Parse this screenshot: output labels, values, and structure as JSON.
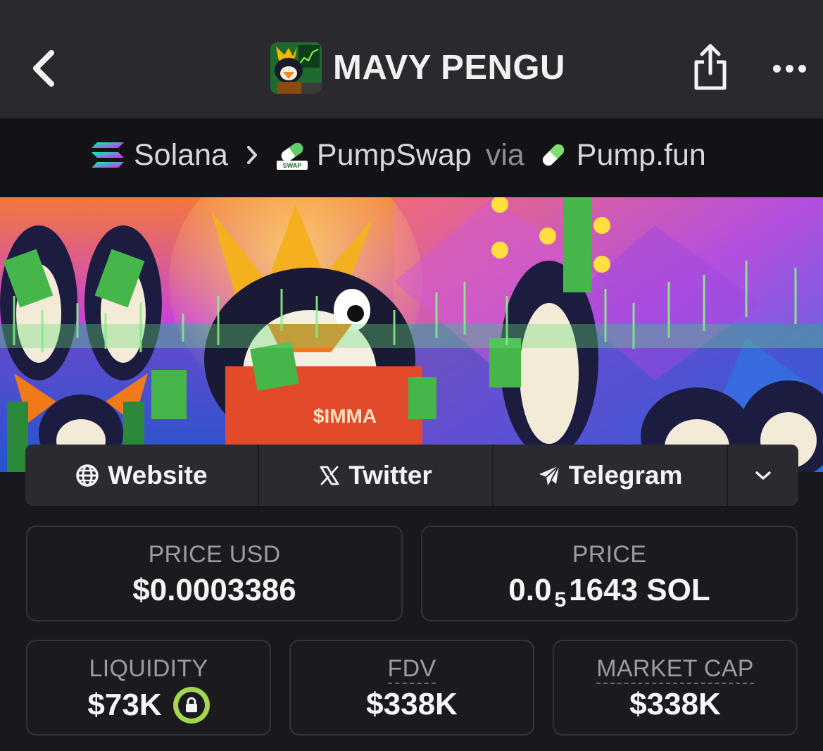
{
  "header": {
    "title": "MAVY PENGU",
    "back_icon": "chevron-left-icon",
    "share_icon": "share-icon",
    "more_icon": "ellipsis-icon"
  },
  "chain": {
    "network": "Solana",
    "dex": "PumpSwap",
    "via_label": "via",
    "launchpad": "Pump.fun"
  },
  "socials": {
    "website": "Website",
    "twitter": "Twitter",
    "telegram": "Telegram"
  },
  "stats": {
    "price_usd_label": "PRICE USD",
    "price_usd_value": "$0.0003386",
    "price_label": "PRICE",
    "price_prefix": "0.0",
    "price_zero_count": "5",
    "price_digits": "1643 SOL",
    "liquidity_label": "LIQUIDITY",
    "liquidity_value": "$73K",
    "fdv_label": "FDV",
    "fdv_value": "$338K",
    "mcap_label": "MARKET CAP",
    "mcap_value": "$338K"
  },
  "colors": {
    "header_bg": "#2a292e",
    "chain_bg": "#131317",
    "page_bg": "#19181e",
    "lock_accent": "#a5d64f"
  }
}
